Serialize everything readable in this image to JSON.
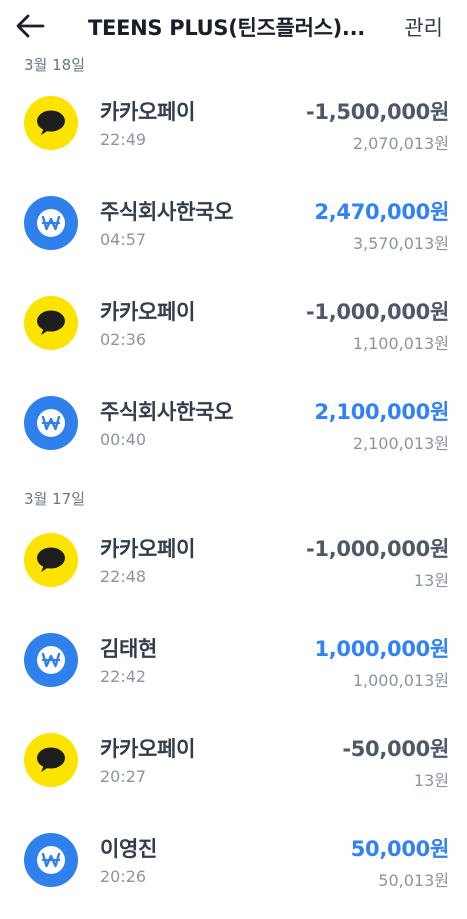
{
  "header": {
    "title": "TEENS PLUS(틴즈플러스)...",
    "manage_label": "관리",
    "back_icon": "back-arrow-icon"
  },
  "colors": {
    "kakao_yellow": "#fde300",
    "won_blue": "#2f80ed",
    "positive_amount": "#3182f6",
    "negative_amount": "#4e5968"
  },
  "groups": [
    {
      "date": "3월 18일",
      "transactions": [
        {
          "icon": "kakaopay-icon",
          "name": "카카오페이",
          "time": "22:49",
          "amount": "-1,500,000원",
          "balance": "2,070,013원"
        },
        {
          "icon": "won-icon",
          "name": "주식회사한국오",
          "time": "04:57",
          "amount": "2,470,000원",
          "balance": "3,570,013원"
        },
        {
          "icon": "kakaopay-icon",
          "name": "카카오페이",
          "time": "02:36",
          "amount": "-1,000,000원",
          "balance": "1,100,013원"
        },
        {
          "icon": "won-icon",
          "name": "주식회사한국오",
          "time": "00:40",
          "amount": "2,100,000원",
          "balance": "2,100,013원"
        }
      ]
    },
    {
      "date": "3월 17일",
      "transactions": [
        {
          "icon": "kakaopay-icon",
          "name": "카카오페이",
          "time": "22:48",
          "amount": "-1,000,000원",
          "balance": "13원"
        },
        {
          "icon": "won-icon",
          "name": "김태현",
          "time": "22:42",
          "amount": "1,000,000원",
          "balance": "1,000,013원"
        },
        {
          "icon": "kakaopay-icon",
          "name": "카카오페이",
          "time": "20:27",
          "amount": "-50,000원",
          "balance": "13원"
        },
        {
          "icon": "won-icon",
          "name": "이영진",
          "time": "20:26",
          "amount": "50,000원",
          "balance": "50,013원"
        }
      ]
    }
  ]
}
